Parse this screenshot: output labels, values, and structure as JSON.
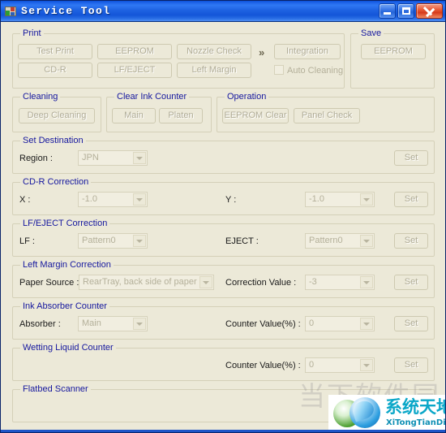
{
  "window": {
    "title": "Service Tool",
    "icon": "printer-icon",
    "minimize_label": "",
    "maximize_label": "",
    "close_label": ""
  },
  "print_group": {
    "title": "Print",
    "buttons": [
      {
        "label": "Test Print"
      },
      {
        "label": "EEPROM"
      },
      {
        "label": "Nozzle Check"
      },
      {
        "label": "CD-R"
      },
      {
        "label": "LF/EJECT"
      },
      {
        "label": "Left Margin"
      }
    ],
    "chevron": "»",
    "integration_label": "Integration",
    "auto_cleaning_label": "Auto Cleaning",
    "auto_cleaning_checked": false
  },
  "save_group": {
    "title": "Save",
    "eeprom_label": "EEPROM"
  },
  "cleaning_group": {
    "title": "Cleaning",
    "deep_cleaning_label": "Deep Cleaning"
  },
  "clear_ink_counter_group": {
    "title": "Clear Ink Counter",
    "main_label": "Main",
    "platen_label": "Platen"
  },
  "operation_group": {
    "title": "Operation",
    "eeprom_clear_label": "EEPROM Clear",
    "panel_check_label": "Panel Check"
  },
  "set_destination": {
    "title": "Set Destination",
    "region_label": "Region :",
    "region_value": "JPN",
    "set_label": "Set"
  },
  "cdr_correction": {
    "title": "CD-R Correction",
    "x_label": "X :",
    "x_value": "-1.0",
    "y_label": "Y :",
    "y_value": "-1.0",
    "set_label": "Set"
  },
  "lf_eject_correction": {
    "title": "LF/EJECT Correction",
    "lf_label": "LF :",
    "lf_value": "Pattern0",
    "eject_label": "EJECT :",
    "eject_value": "Pattern0",
    "set_label": "Set"
  },
  "left_margin_correction": {
    "title": "Left Margin Correction",
    "paper_source_label": "Paper Source :",
    "paper_source_value": "RearTray, back side of paper",
    "correction_value_label": "Correction Value :",
    "correction_value": "-3",
    "set_label": "Set"
  },
  "ink_absorber_counter": {
    "title": "Ink Absorber Counter",
    "absorber_label": "Absorber :",
    "absorber_value": "Main",
    "counter_value_label": "Counter Value(%) :",
    "counter_value": "0",
    "set_label": "Set"
  },
  "wetting_liquid_counter": {
    "title": "Wetting Liquid Counter",
    "counter_value_label": "Counter Value(%) :",
    "counter_value": "0",
    "set_label": "Set"
  },
  "flatbed_scanner": {
    "title": "Flatbed Scanner"
  },
  "watermark": {
    "ghost_text": "当下软件园",
    "logo_cn": "系统天地",
    "logo_en": "XiTongTianDi.net"
  },
  "colors": {
    "window_bg": "#ece9d8",
    "group_title": "#15179e",
    "titlebar_blue": "#1f63e2",
    "close_red": "#d63a1a"
  }
}
